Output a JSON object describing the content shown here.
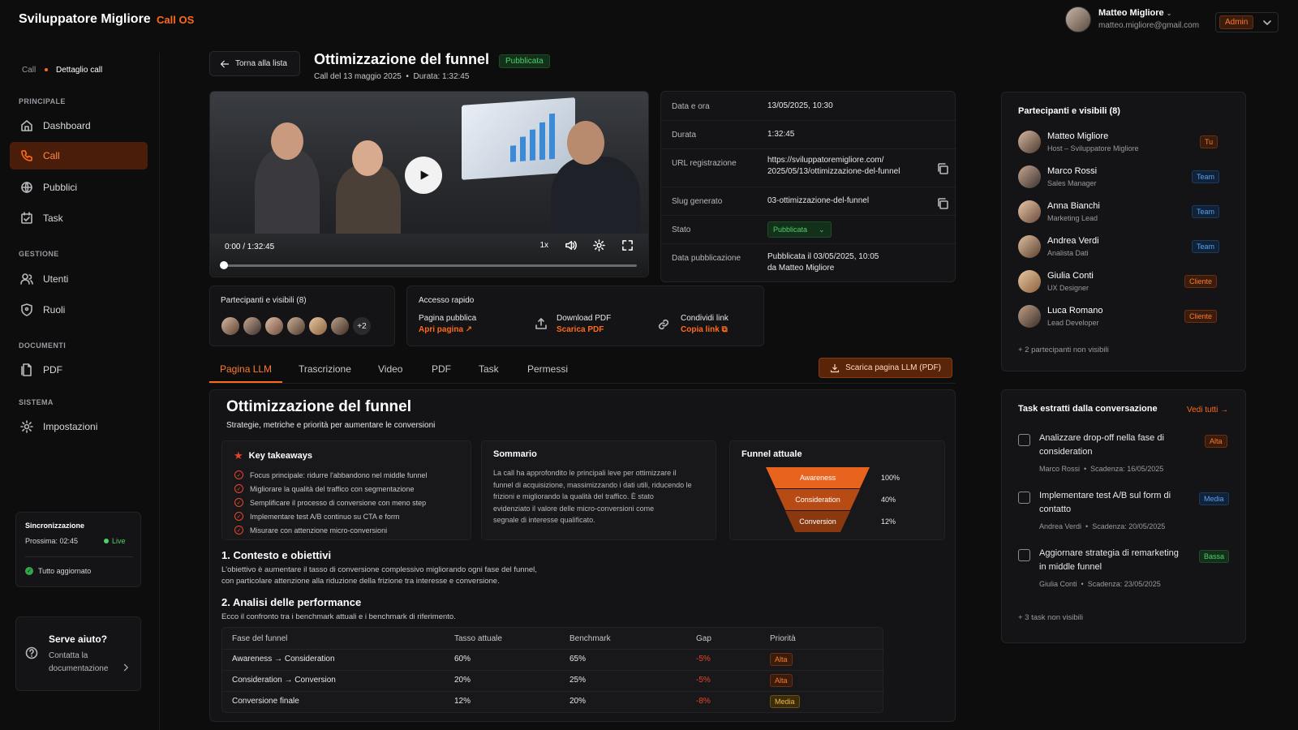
{
  "header": {
    "brand": "Sviluppatore Migliore",
    "app": "Call OS",
    "user_name": "Matteo Migliore",
    "user_email": "matteo.migliore@gmail.com",
    "role": "Admin"
  },
  "breadcrumb": {
    "root": "Call",
    "current": "Dettaglio call"
  },
  "sidebar": {
    "sections": [
      {
        "title": "PRINCIPALE",
        "items": [
          "Dashboard",
          "Call",
          "Pubblici",
          "Task"
        ]
      },
      {
        "title": "GESTIONE",
        "items": [
          "Utenti",
          "Ruoli"
        ]
      },
      {
        "title": "DOCUMENTI",
        "items": [
          "PDF"
        ]
      },
      {
        "title": "SISTEMA",
        "items": [
          "Impostazioni"
        ]
      }
    ],
    "active": "Call",
    "sync": {
      "title": "Sincronizzazione",
      "next": "Prossima: 02:45",
      "live": "Live",
      "status": "Tutto aggiornato"
    },
    "help": {
      "title": "Serve aiuto?",
      "text1": "Contatta la",
      "text2": "documentazione"
    }
  },
  "call": {
    "back": "Torna alla lista",
    "title": "Ottimizzazione del funnel",
    "status": "Pubblicata",
    "date": "Call del 13 maggio 2025",
    "duration": "Durata: 1:32:45"
  },
  "video": {
    "time": "0:00 / 1:32:45",
    "speed": "1x"
  },
  "details": {
    "rows": [
      {
        "label": "Data e ora",
        "value": "13/05/2025, 10:30"
      },
      {
        "label": "Durata",
        "value": "1:32:45"
      },
      {
        "label": "URL registrazione",
        "value": "https://sviluppatoremigliore.com/",
        "value2": "2025/05/13/ottimizzazione-del-funnel"
      },
      {
        "label": "Slug generato",
        "value": "03-ottimizzazione-del-funnel"
      },
      {
        "label": "Stato",
        "value": "Pubblicata"
      },
      {
        "label": "Data pubblicazione",
        "value": "Pubblicata il 03/05/2025, 10:05",
        "value2": "da Matteo Migliore"
      }
    ]
  },
  "participants_small": {
    "title": "Partecipanti e visibili (8)",
    "more": "+2"
  },
  "quick": {
    "title": "Accesso rapido",
    "items": [
      {
        "label": "Pagina pubblica",
        "action": "Apri pagina"
      },
      {
        "label": "Download PDF",
        "action": "Scarica PDF"
      },
      {
        "label": "Condividi link",
        "action": "Copia link"
      }
    ]
  },
  "tabs": [
    "Pagina LLM",
    "Trascrizione",
    "Video",
    "PDF",
    "Task",
    "Permessi"
  ],
  "download_llm": "Scarica pagina LLM (PDF)",
  "content": {
    "title": "Ottimizzazione del funnel",
    "subtitle": "Strategie, metriche e priorità per aumentare le conversioni",
    "takeaways_title": "Key takeaways",
    "takeaways": [
      "Focus principale: ridurre l'abbandono nel middle funnel",
      "Migliorare la qualità del traffico con segmentazione",
      "Semplificare il processo di conversione con meno step",
      "Implementare test A/B continuo su CTA e form",
      "Misurare con attenzione micro-conversioni"
    ],
    "summary_title": "Sommario",
    "summary": [
      "La call ha approfondito le principali leve per ottimizzare il",
      "funnel di acquisizione, massimizzando i dati utili, riducendo le",
      "frizioni e migliorando la qualità del traffico. È stato",
      "evidenziato il valore delle micro-conversioni come",
      "segnale di interesse qualificato."
    ],
    "funnel_title": "Funnel attuale",
    "funnel": [
      {
        "stage": "Awareness",
        "value": "100%"
      },
      {
        "stage": "Consideration",
        "value": "40%"
      },
      {
        "stage": "Conversion",
        "value": "12%"
      }
    ],
    "s1_title": "1. Contesto e obiettivi",
    "s1_text1": "L'obiettivo è aumentare il tasso di conversione complessivo migliorando ogni fase del funnel,",
    "s1_text2": "con particolare attenzione alla riduzione della frizione tra interesse e conversione.",
    "s2_title": "2. Analisi delle performance",
    "s2_text": "Ecco il confronto tra i benchmark attuali e i benchmark di riferimento.",
    "table": {
      "headers": [
        "Fase del funnel",
        "Tasso attuale",
        "Benchmark",
        "Gap",
        "Priorità"
      ],
      "rows": [
        [
          "Awareness → Consideration",
          "60%",
          "65%",
          "-5%",
          "Alta"
        ],
        [
          "Consideration → Conversion",
          "20%",
          "25%",
          "-5%",
          "Alta"
        ],
        [
          "Conversione finale",
          "12%",
          "20%",
          "-8%",
          "Media"
        ]
      ]
    }
  },
  "right_participants": {
    "title": "Partecipanti e visibili (8)",
    "people": [
      {
        "name": "Matteo Migliore",
        "role": "Host – Sviluppatore Migliore",
        "tag": "Tu"
      },
      {
        "name": "Marco Rossi",
        "role": "Sales Manager",
        "tag": "Team"
      },
      {
        "name": "Anna Bianchi",
        "role": "Marketing Lead",
        "tag": "Team"
      },
      {
        "name": "Andrea Verdi",
        "role": "Analista Dati",
        "tag": "Team"
      },
      {
        "name": "Giulia Conti",
        "role": "UX Designer",
        "tag": "Cliente"
      },
      {
        "name": "Luca Romano",
        "role": "Lead Developer",
        "tag": "Cliente"
      }
    ],
    "more": "+ 2 partecipanti non visibili"
  },
  "right_tasks": {
    "title": "Task estratti dalla conversazione",
    "see_all": "Vedi tutti",
    "tasks": [
      {
        "title1": "Analizzare drop-off nella fase di",
        "title2": "consideration",
        "owner": "Marco Rossi",
        "due": "Scadenza: 16/05/2025",
        "priority": "Alta"
      },
      {
        "title1": "Implementare test A/B sul form di",
        "title2": "contatto",
        "owner": "Andrea Verdi",
        "due": "Scadenza: 20/05/2025",
        "priority": "Media"
      },
      {
        "title1": "Aggiornare strategia di remarketing",
        "title2": "in middle funnel",
        "owner": "Giulia Conti",
        "due": "Scadenza: 23/05/2025",
        "priority": "Bassa"
      }
    ],
    "more": "+ 3 task non visibili"
  }
}
